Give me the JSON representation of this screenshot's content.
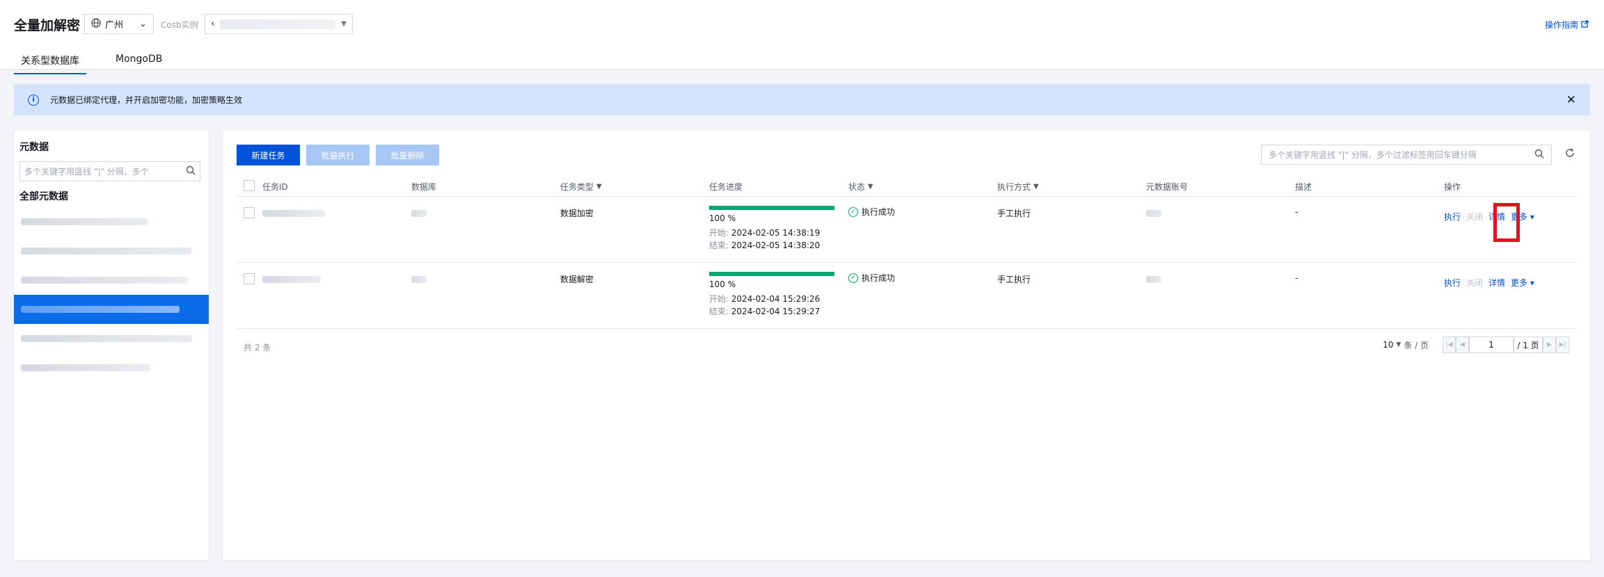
{
  "header": {
    "title": "全量加解密",
    "region": "广州",
    "instance_label": "Cosb实例",
    "instance_prefix": "‹",
    "guide_link": "操作指南"
  },
  "tabs": [
    {
      "label": "关系型数据库",
      "active": true
    },
    {
      "label": "MongoDB",
      "active": false
    }
  ],
  "alert": {
    "message": "元数据已绑定代理，并开启加密功能，加密策略生效"
  },
  "sidebar": {
    "title": "元数据",
    "search_placeholder": "多个关键字用竖线 \"|\" 分隔，多个",
    "all_label": "全部元数据",
    "selected_index": 3
  },
  "toolbar": {
    "new_task": "新建任务",
    "batch_execute": "批量执行",
    "batch_delete": "批量删除",
    "search_placeholder": "多个关键字用竖线 \"|\" 分隔，多个过滤标签用回车键分隔"
  },
  "table": {
    "columns": {
      "task_id": "任务ID",
      "database": "数据库",
      "task_type": "任务类型",
      "progress": "任务进度",
      "status": "状态",
      "exec_mode": "执行方式",
      "meta_account": "元数据账号",
      "desc": "描述",
      "ops": "操作"
    },
    "start_label": "开始:",
    "end_label": "结束:",
    "rows": [
      {
        "task_type": "数据加密",
        "progress_text": "100 %",
        "progress": 1.0,
        "start": "2024-02-05 14:38:19",
        "end": "2024-02-05 14:38:20",
        "status": "执行成功",
        "exec_mode": "手工执行",
        "desc": "-",
        "ops": {
          "execute": "执行",
          "close": "关闭",
          "detail": "详情",
          "more": "更多"
        }
      },
      {
        "task_type": "数据解密",
        "progress_text": "100 %",
        "progress": 1.0,
        "start": "2024-02-04 15:29:26",
        "end": "2024-02-04 15:29:27",
        "status": "执行成功",
        "exec_mode": "手工执行",
        "desc": "-",
        "ops": {
          "execute": "执行",
          "close": "关闭",
          "detail": "详情",
          "more": "更多"
        }
      }
    ]
  },
  "pagination": {
    "total": "共 2 条",
    "page_size": "10",
    "page_size_unit": "条 / 页",
    "current": "1",
    "total_pages": "/ 1 页"
  },
  "colors": {
    "primary": "#0052d9",
    "success": "#00a870",
    "selected_item": "#0a6ce9",
    "alert_bg": "#d4e3fc",
    "highlight": "#e8101d"
  }
}
